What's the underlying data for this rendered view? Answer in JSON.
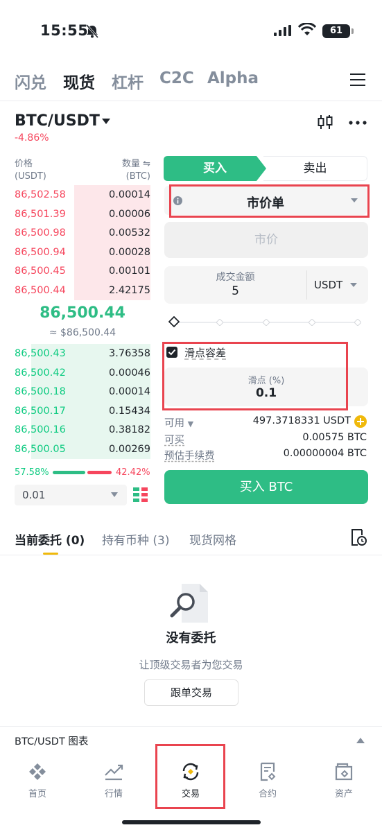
{
  "status": {
    "time": "15:55",
    "battery": "61"
  },
  "top_nav": {
    "tabs": [
      "闪兑",
      "现货",
      "杠杆",
      "C2C",
      "Alpha"
    ]
  },
  "pair": {
    "name": "BTC/USDT",
    "change": "-4.86%"
  },
  "orderbook": {
    "price_header": "价格",
    "price_unit": "(USDT)",
    "qty_header": "数量 ⇋",
    "qty_unit": "(BTC)",
    "asks": [
      {
        "price": "86,502.58",
        "qty": "0.00014",
        "depth": 0.56
      },
      {
        "price": "86,501.39",
        "qty": "0.00006",
        "depth": 0.56
      },
      {
        "price": "86,500.98",
        "qty": "0.00532",
        "depth": 0.56
      },
      {
        "price": "86,500.94",
        "qty": "0.00028",
        "depth": 0.56
      },
      {
        "price": "86,500.45",
        "qty": "0.00101",
        "depth": 0.56
      },
      {
        "price": "86,500.44",
        "qty": "2.42175",
        "depth": 0.56
      }
    ],
    "mid_price": "86,500.44",
    "mid_usd": "≈ $86,500.44",
    "bids": [
      {
        "price": "86,500.43",
        "qty": "3.76358",
        "depth": 0.88
      },
      {
        "price": "86,500.42",
        "qty": "0.00046",
        "depth": 0.88
      },
      {
        "price": "86,500.18",
        "qty": "0.00014",
        "depth": 0.88
      },
      {
        "price": "86,500.17",
        "qty": "0.15434",
        "depth": 0.88
      },
      {
        "price": "86,500.16",
        "qty": "0.38182",
        "depth": 0.88
      },
      {
        "price": "86,500.05",
        "qty": "0.00269",
        "depth": 0.88
      }
    ],
    "buy_ratio": "57.58%",
    "sell_ratio": "42.42%",
    "depth_value": "0.01"
  },
  "form": {
    "buy_tab": "买入",
    "sell_tab": "卖出",
    "order_type": "市价单",
    "market_placeholder": "市价",
    "amount_label": "成交金额",
    "amount_value": "5",
    "amount_unit": "USDT",
    "slippage_label": "滑点容差",
    "slippage_field_label": "滑点 (%)",
    "slippage_value": "0.1",
    "available_label": "可用",
    "available_value": "497.3718331 USDT",
    "can_buy_label": "可买",
    "can_buy_value": "0.00575 BTC",
    "fee_label": "预估手续费",
    "fee_value": "0.00000004 BTC",
    "buy_button": "买入 BTC"
  },
  "orders": {
    "tabs": [
      "当前委托 (0)",
      "持有币种 (3)",
      "现货网格"
    ],
    "empty_title": "没有委托",
    "empty_sub": "让顶级交易者为您交易",
    "copy_button": "跟单交易"
  },
  "chart_bar": {
    "label": "BTC/USDT 图表"
  },
  "bottom_nav": [
    "首页",
    "行情",
    "交易",
    "合约",
    "资产"
  ],
  "colors": {
    "buy": "#2ebd85",
    "sell": "#f6465d",
    "accent": "#f0b90b",
    "highlight": "#e9444f"
  }
}
